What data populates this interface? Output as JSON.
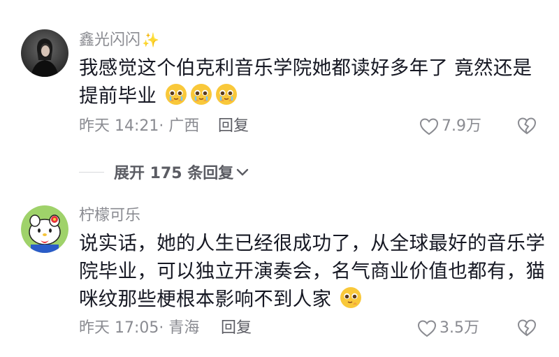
{
  "comments": [
    {
      "username": "鑫光闪闪",
      "username_emoji": "✨",
      "text": "我感觉这个伯克利音乐学院她都读好多年了 竟然还是提前毕业",
      "trailing_emojis": [
        "pleading-face",
        "pleading-face",
        "pleading-face"
      ],
      "timestamp": "昨天 14:21",
      "location": "· 广西",
      "reply_label": "回复",
      "likes": "7.9万"
    },
    {
      "username": "柠檬可乐",
      "text": "说实话，她的人生已经很成功了，从全球最好的音乐学院毕业，可以独立开演奏会，名气商业价值也都有，猫咪纹那些梗根本影响不到人家",
      "trailing_emojis": [
        "pleading-face"
      ],
      "timestamp": "昨天 17:05",
      "location": "· 青海",
      "reply_label": "回复",
      "likes": "3.5万"
    }
  ],
  "expand_replies": {
    "label": "展开 175 条回复"
  },
  "icons": {
    "like": "heart-outline-icon",
    "dislike": "broken-heart-icon",
    "expand": "chevron-down-icon"
  },
  "colors": {
    "primary_text": "#161823",
    "secondary_text": "#8a8b91",
    "reply_text": "#5b5c63"
  }
}
